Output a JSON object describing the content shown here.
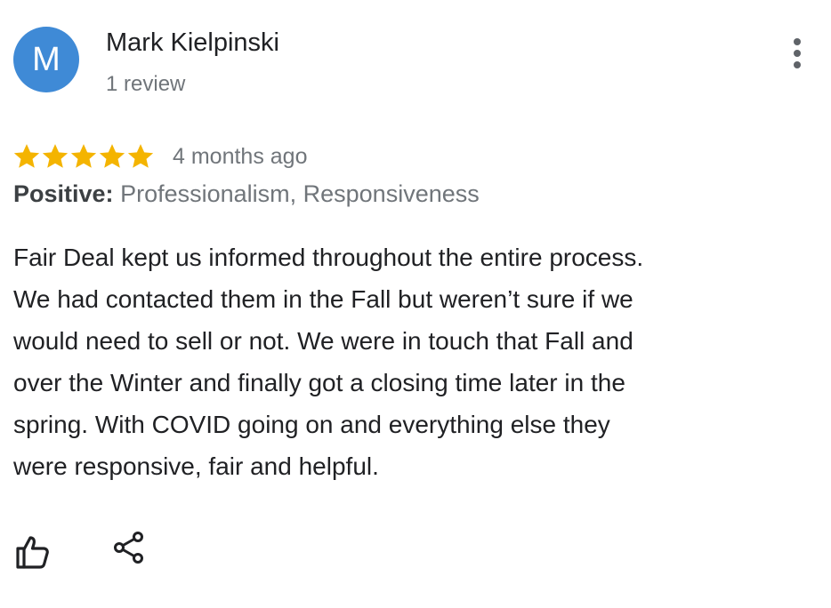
{
  "reviewer": {
    "avatar_letter": "M",
    "avatar_color": "#3f8ad6",
    "name": "Mark Kielpinski",
    "review_count": "1 review"
  },
  "review": {
    "rating": 5,
    "max_rating": 5,
    "star_color": "#f4b400",
    "time": "4 months ago",
    "highlight_label": "Positive:",
    "highlight_values": "Professionalism, Responsiveness",
    "text_lines": [
      "Fair Deal kept us informed throughout the entire process.",
      "We had contacted them in the Fall but weren’t sure if we",
      "would need to sell or not. We were in touch that Fall and",
      "over the Winter and finally got a closing time later in the",
      "spring. With COVID going on and everything else they",
      "were responsive, fair and helpful."
    ]
  },
  "actions": {
    "more_icon": "more-vert-icon",
    "like_icon": "thumbs-up-icon",
    "share_icon": "share-icon"
  }
}
